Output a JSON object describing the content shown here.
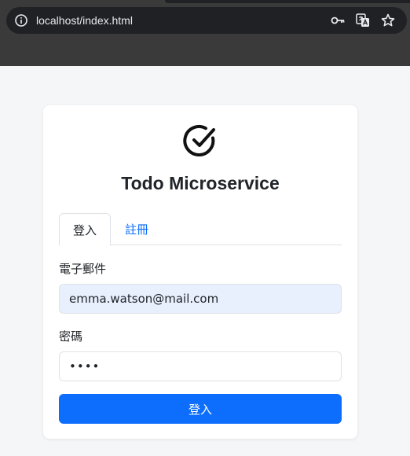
{
  "browser": {
    "url": "localhost/index.html"
  },
  "icons": {
    "site_info": "info-icon",
    "password_manager": "key-icon",
    "translate": "translate-icon",
    "bookmark": "star-icon",
    "logo": "check-circle-icon"
  },
  "card": {
    "title": "Todo Microservice",
    "tabs": [
      {
        "label": "登入",
        "active": true
      },
      {
        "label": "註冊",
        "active": false
      }
    ],
    "email": {
      "label": "電子郵件",
      "value": "emma.watson@mail.com"
    },
    "password": {
      "label": "密碼",
      "value": "••••"
    },
    "submit_label": "登入"
  },
  "colors": {
    "accent": "#0d6efd",
    "autofill_bg": "#e8f0fe",
    "browser_chrome": "#3a3a3a"
  }
}
